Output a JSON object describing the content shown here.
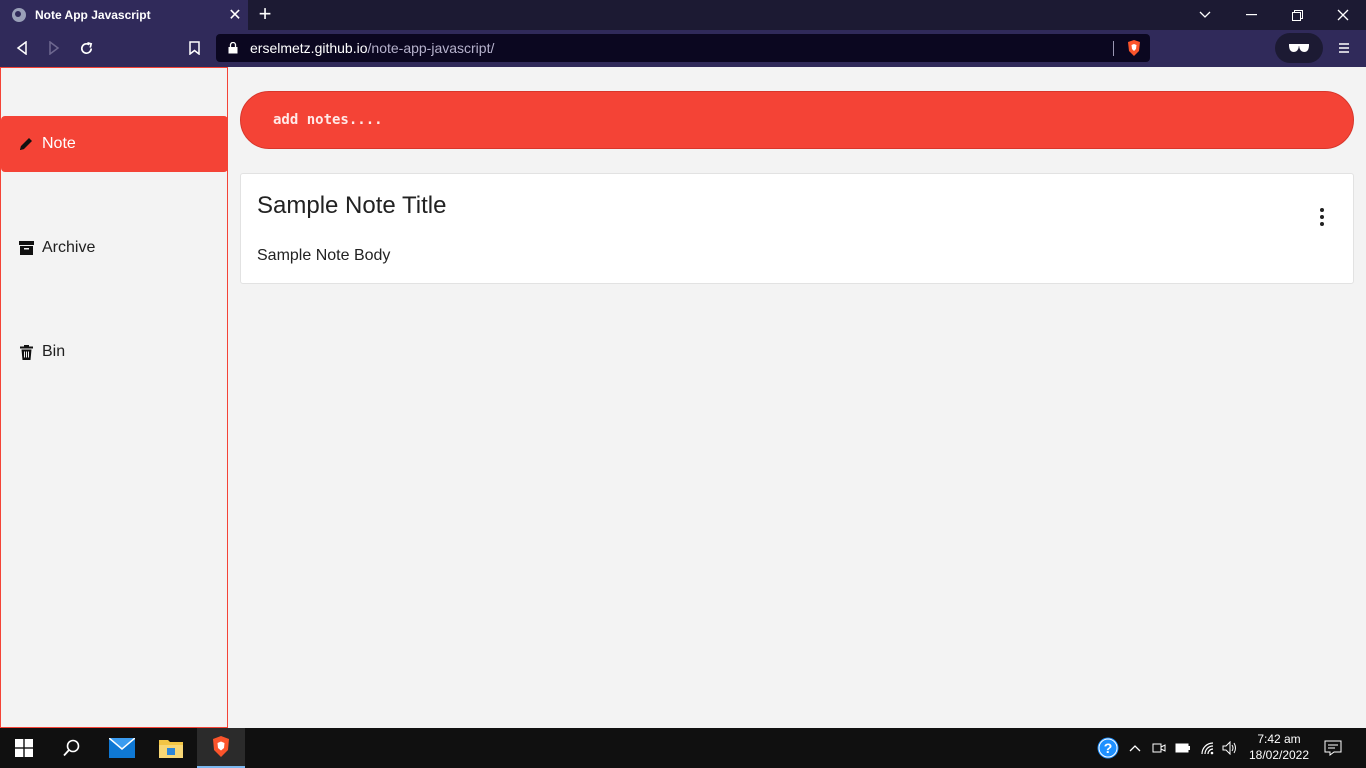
{
  "browser": {
    "tab_title": "Note App Javascript",
    "tab_close": "✕",
    "new_tab": "+",
    "url_host": "erselmetz.github.io",
    "url_path": "/note-app-javascript/"
  },
  "sidebar": {
    "items": [
      {
        "label": "Note",
        "icon": "pencil-icon",
        "active": true
      },
      {
        "label": "Archive",
        "icon": "archive-box-icon",
        "active": false
      },
      {
        "label": "Bin",
        "icon": "trash-icon",
        "active": false
      }
    ]
  },
  "main": {
    "add_placeholder": "add notes....",
    "notes": [
      {
        "title": "Sample Note Title",
        "body": "Sample Note Body"
      }
    ]
  },
  "taskbar": {
    "time": "7:42 am",
    "date": "18/02/2022"
  },
  "colors": {
    "accent": "#f44336",
    "browser_chrome": "#302a5a",
    "tabstrip": "#1c1a33"
  }
}
